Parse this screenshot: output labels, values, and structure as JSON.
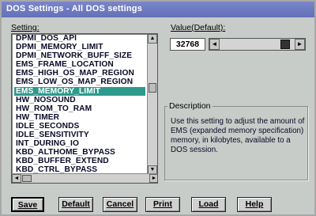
{
  "window": {
    "title": "DOS Settings - All DOS settings"
  },
  "setting_label": "Setting:",
  "value_label": "Value(Default):",
  "settings": [
    "DPMI_DOS_API",
    "DPMI_MEMORY_LIMIT",
    "DPMI_NETWORK_BUFF_SIZE",
    "EMS_FRAME_LOCATION",
    "EMS_HIGH_OS_MAP_REGION",
    "EMS_LOW_OS_MAP_REGION",
    "EMS_MEMORY_LIMIT",
    "HW_NOSOUND",
    "HW_ROM_TO_RAM",
    "HW_TIMER",
    "IDLE_SECONDS",
    "IDLE_SENSITIVITY",
    "INT_DURING_IO",
    "KBD_ALTHOME_BYPASS",
    "KBD_BUFFER_EXTEND",
    "KBD_CTRL_BYPASS"
  ],
  "selected_index": 6,
  "value": {
    "current": "32768",
    "slider_fraction": 0.93
  },
  "description": {
    "title": "Description",
    "text": "Use this setting to adjust the amount of EMS (expanded memory specification) memory, in kilobytes, available to a DOS session."
  },
  "buttons": {
    "save": "Save",
    "default": "Default",
    "cancel": "Cancel",
    "print": "Print",
    "load": "Load",
    "help": "Help"
  },
  "icons": {
    "arrow_up": "▲",
    "arrow_down": "▼",
    "arrow_left": "◄",
    "arrow_right": "►"
  }
}
